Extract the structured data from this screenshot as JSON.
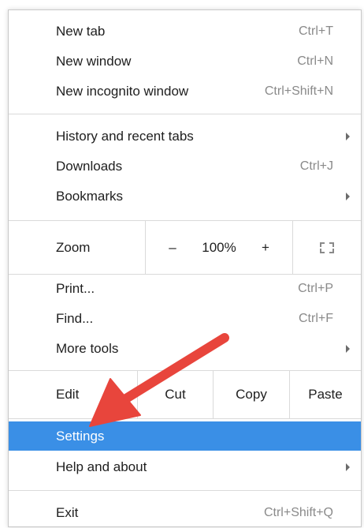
{
  "menu": {
    "new_tab": {
      "label": "New tab",
      "shortcut": "Ctrl+T"
    },
    "new_window": {
      "label": "New window",
      "shortcut": "Ctrl+N"
    },
    "new_incognito": {
      "label": "New incognito window",
      "shortcut": "Ctrl+Shift+N"
    },
    "history": {
      "label": "History and recent tabs"
    },
    "downloads": {
      "label": "Downloads",
      "shortcut": "Ctrl+J"
    },
    "bookmarks": {
      "label": "Bookmarks"
    },
    "zoom": {
      "label": "Zoom",
      "minus": "–",
      "level": "100%",
      "plus": "+"
    },
    "print": {
      "label": "Print...",
      "shortcut": "Ctrl+P"
    },
    "find": {
      "label": "Find...",
      "shortcut": "Ctrl+F"
    },
    "more_tools": {
      "label": "More tools"
    },
    "edit": {
      "label": "Edit",
      "cut": "Cut",
      "copy": "Copy",
      "paste": "Paste"
    },
    "settings": {
      "label": "Settings"
    },
    "help": {
      "label": "Help and about"
    },
    "exit": {
      "label": "Exit",
      "shortcut": "Ctrl+Shift+Q"
    }
  },
  "colors": {
    "highlight": "#3a8fe6",
    "annotation_arrow": "#e8453c"
  },
  "icons": {
    "fullscreen": "fullscreen-icon",
    "submenu": "submenu-arrow-icon",
    "annotation": "red-arrow-annotation"
  }
}
